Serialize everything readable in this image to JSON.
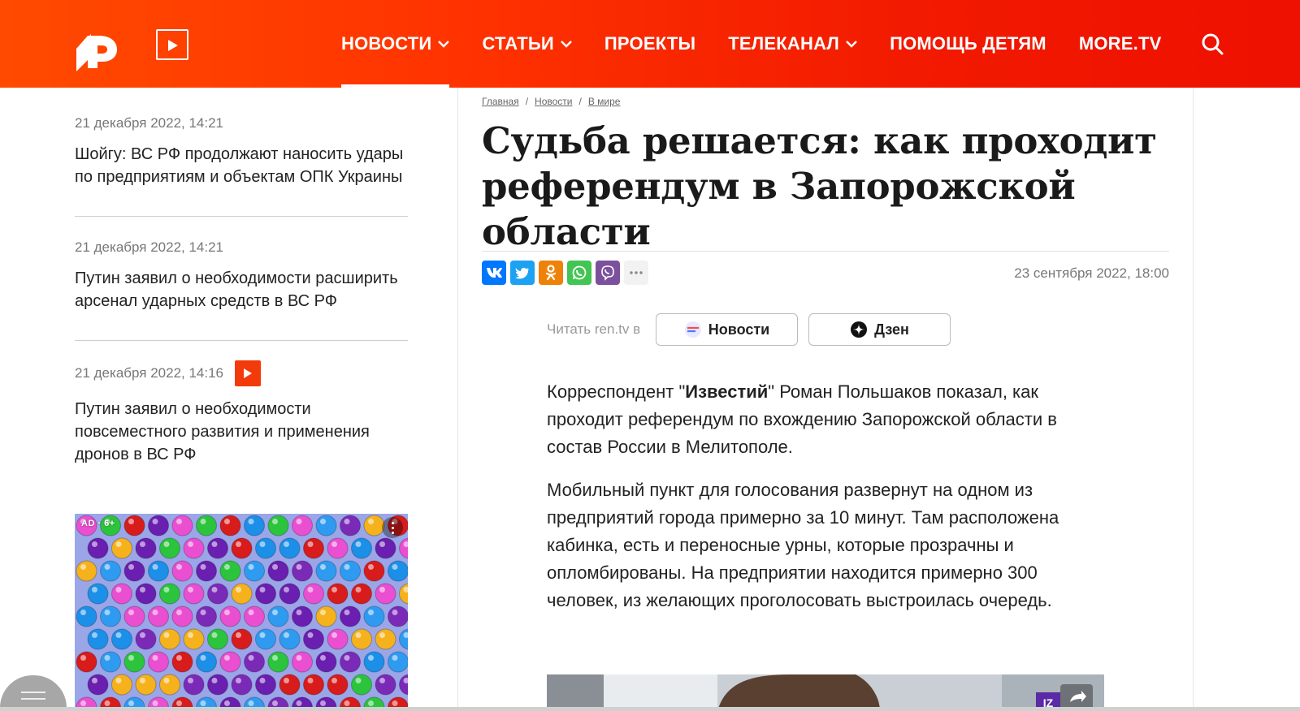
{
  "header": {
    "nav": [
      {
        "label": "НОВОСТИ",
        "has_dropdown": true,
        "active": true
      },
      {
        "label": "СТАТЬИ",
        "has_dropdown": true,
        "active": false
      },
      {
        "label": "ПРОЕКТЫ",
        "has_dropdown": false,
        "active": false
      },
      {
        "label": "ТЕЛЕКАНАЛ",
        "has_dropdown": true,
        "active": false
      },
      {
        "label": "ПОМОЩЬ ДЕТЯМ",
        "has_dropdown": false,
        "active": false
      },
      {
        "label": "MORE.TV",
        "has_dropdown": false,
        "active": false
      }
    ],
    "icons": [
      "ren-logo-icon",
      "play-icon",
      "search-icon"
    ]
  },
  "sidebar": {
    "news": [
      {
        "date": "21 декабря 2022, 14:21",
        "title": "Шойгу: ВС РФ продолжают наносить удары по предприятиям и объектам ОПК Украины",
        "video": false
      },
      {
        "date": "21 декабря 2022, 14:21",
        "title": "Путин заявил о необходимости расширить арсенал ударных средств в ВС РФ",
        "video": false
      },
      {
        "date": "21 декабря 2022, 14:16",
        "title": "Путин заявил о необходимости повсеместного развития и применения дронов в ВС РФ",
        "video": true
      }
    ],
    "ad_label": "AD · 6+"
  },
  "breadcrumb": [
    "Главная",
    "Новости",
    "В мире"
  ],
  "article": {
    "title": "Судьба решается: как проходит референдум в Запорожской области",
    "date": "23 сентября 2022, 18:00",
    "read_label": "Читать ren.tv в",
    "read_news": "Новости",
    "read_dzen": "Дзен",
    "p1_before": "Корреспондент \"",
    "p1_bold": "Известий",
    "p1_after": "\" Роман Польшаков показал, как проходит референдум по вхождению Запорожской области в состав России в Мелитополе.",
    "p2": "Мобильный пункт для голосования развернут на одном из предприятий города примерно за 10 минут. Там расположена кабинка, есть и переносные урны, которые прозрачны и опломбированы. На предприятии находится примерно 300 человек, из желающих проголосовать выстроилась очередь."
  },
  "share": [
    {
      "name": "vk",
      "color": "#0077ff"
    },
    {
      "name": "twitter",
      "color": "#1da1f2"
    },
    {
      "name": "odnoklassniki",
      "color": "#ee8208"
    },
    {
      "name": "whatsapp",
      "color": "#43c553"
    },
    {
      "name": "viber",
      "color": "#7b519d"
    },
    {
      "name": "more",
      "color": "#f2f2f2"
    }
  ],
  "colors": {
    "brand": "#f33a0a",
    "accent": "#ee1000"
  }
}
